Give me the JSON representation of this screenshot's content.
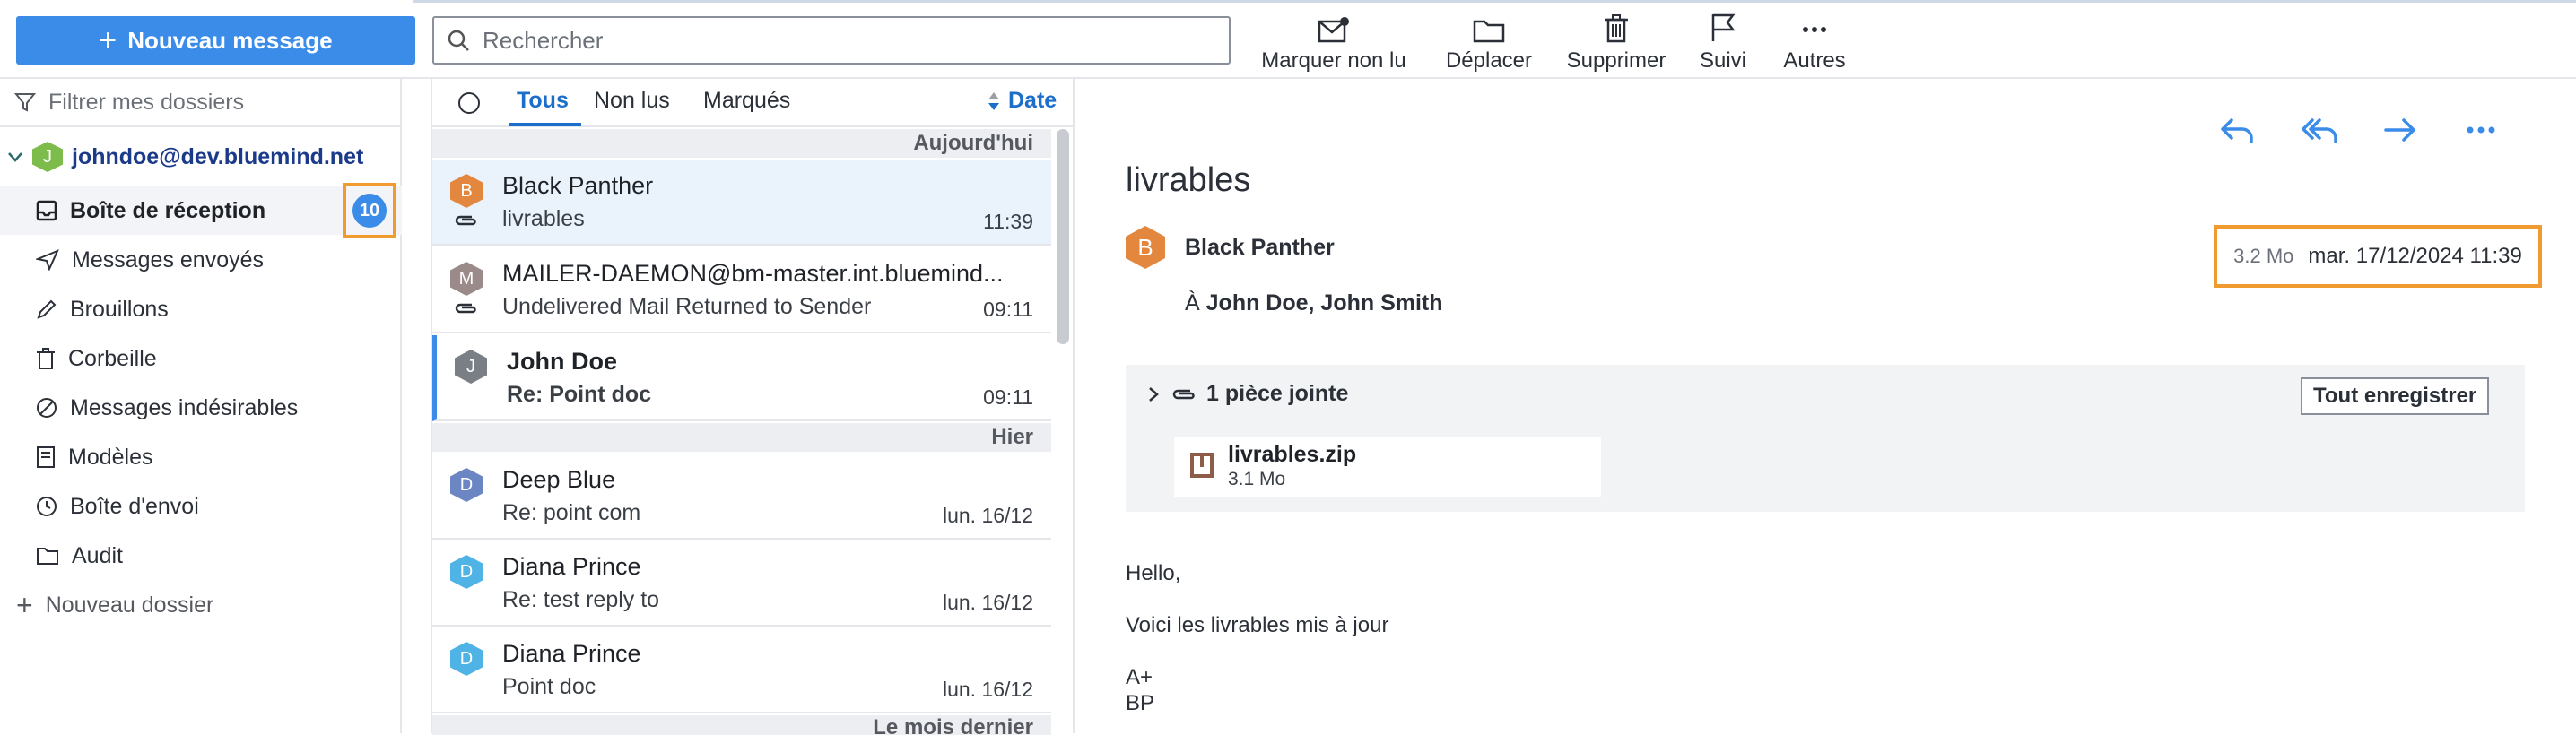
{
  "toolbar": {
    "new_message": "Nouveau message",
    "search_placeholder": "Rechercher",
    "actions": {
      "mark_unread": "Marquer non lu",
      "move": "Déplacer",
      "delete": "Supprimer",
      "follow": "Suivi",
      "more": "Autres"
    }
  },
  "sidebar": {
    "filter_placeholder": "Filtrer mes dossiers",
    "account": {
      "initial": "J",
      "email": "johndoe@dev.bluemind.net"
    },
    "folders": [
      {
        "label": "Boîte de réception",
        "icon": "inbox-icon",
        "unread": "10"
      },
      {
        "label": "Messages envoyés",
        "icon": "send-icon"
      },
      {
        "label": "Brouillons",
        "icon": "pencil-icon"
      },
      {
        "label": "Corbeille",
        "icon": "trash-icon"
      },
      {
        "label": "Messages indésirables",
        "icon": "spam-icon"
      },
      {
        "label": "Modèles",
        "icon": "template-icon"
      },
      {
        "label": "Boîte d'envoi",
        "icon": "clock-icon"
      },
      {
        "label": "Audit",
        "icon": "folder-icon"
      }
    ],
    "new_folder": "Nouveau dossier"
  },
  "list": {
    "tabs": {
      "all": "Tous",
      "unread": "Non lus",
      "flagged": "Marqués"
    },
    "sort": "Date",
    "groups": {
      "today": "Aujourd'hui",
      "yesterday": "Hier",
      "last_month": "Le mois dernier"
    },
    "messages": [
      {
        "initial": "B",
        "color": "#e3873e",
        "from": "Black Panther",
        "subject": "livrables",
        "time": "11:39",
        "attachment": true
      },
      {
        "initial": "M",
        "color": "#9a8a8a",
        "from": "MAILER-DAEMON@bm-master.int.bluemind...",
        "subject": "Undelivered Mail Returned to Sender",
        "time": "09:11",
        "attachment": true
      },
      {
        "initial": "J",
        "color": "#7a7f86",
        "from": "John Doe",
        "subject": "Re: Point doc",
        "time": "09:11"
      },
      {
        "initial": "D",
        "color": "#6b86c2",
        "from": "Deep Blue",
        "subject": "Re: point com",
        "time": "lun. 16/12"
      },
      {
        "initial": "D",
        "color": "#4fb3e6",
        "from": "Diana Prince",
        "subject": "Re: test reply to",
        "time": "lun. 16/12"
      },
      {
        "initial": "D",
        "color": "#4fb3e6",
        "from": "Diana Prince",
        "subject": "Point doc",
        "time": "lun. 16/12"
      }
    ]
  },
  "reader": {
    "subject": "livrables",
    "from_initial": "B",
    "from_color": "#e3873e",
    "from": "Black Panther",
    "to_prefix": "À",
    "to": "John Doe, John Smith",
    "size": "3.2 Mo",
    "date": "mar. 17/12/2024 11:39",
    "attachments_title": "1 pièce jointe",
    "save_all": "Tout enregistrer",
    "attachment": {
      "name": "livrables.zip",
      "size": "3.1 Mo"
    },
    "body": [
      "Hello,",
      "Voici les livrables mis à jour",
      "A+",
      "BP"
    ]
  },
  "colors": {
    "accent": "#3a8ce8",
    "highlight": "#ef9b30"
  }
}
